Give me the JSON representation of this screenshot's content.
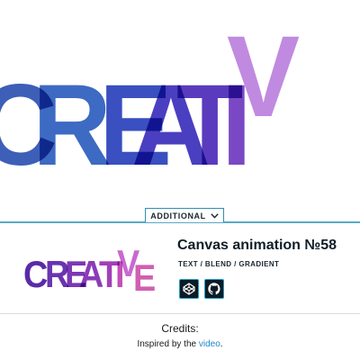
{
  "hero": {
    "letters": [
      {
        "char": "C",
        "color": "#3d5fb8"
      },
      {
        "char": "R",
        "color": "#3d6ac2"
      },
      {
        "char": "E",
        "color": "#3a4fc0"
      },
      {
        "char": "A",
        "color": "#4a3fc0"
      },
      {
        "char": "T",
        "color": "#5a3bbd"
      },
      {
        "char": "I",
        "color": "#7a48c4"
      },
      {
        "char": "V",
        "color": "#c08ae0"
      }
    ]
  },
  "toggle": {
    "label": "ADDITIONAL"
  },
  "card": {
    "title": "Canvas animation №58",
    "tags": "TEXT / BLEND / GRADIENT",
    "thumb_letters": [
      {
        "char": "C",
        "color": "#5a2aa8"
      },
      {
        "char": "R",
        "color": "#6a34b0"
      },
      {
        "char": "E",
        "color": "#7a38b4"
      },
      {
        "char": "A",
        "color": "#8a3cb8"
      },
      {
        "char": "T",
        "color": "#a23fb8"
      },
      {
        "char": "I",
        "color": "#c44fb8"
      },
      {
        "char": "V",
        "color": "#c86ad0"
      },
      {
        "char": "E",
        "color": "#d060b0"
      }
    ],
    "links": [
      {
        "icon": "codepen-icon"
      },
      {
        "icon": "github-icon"
      }
    ]
  },
  "footer": {
    "credits_label": "Credits:",
    "inspired_prefix": "Inspired by the ",
    "inspired_link": "video",
    "inspired_suffix": "."
  }
}
